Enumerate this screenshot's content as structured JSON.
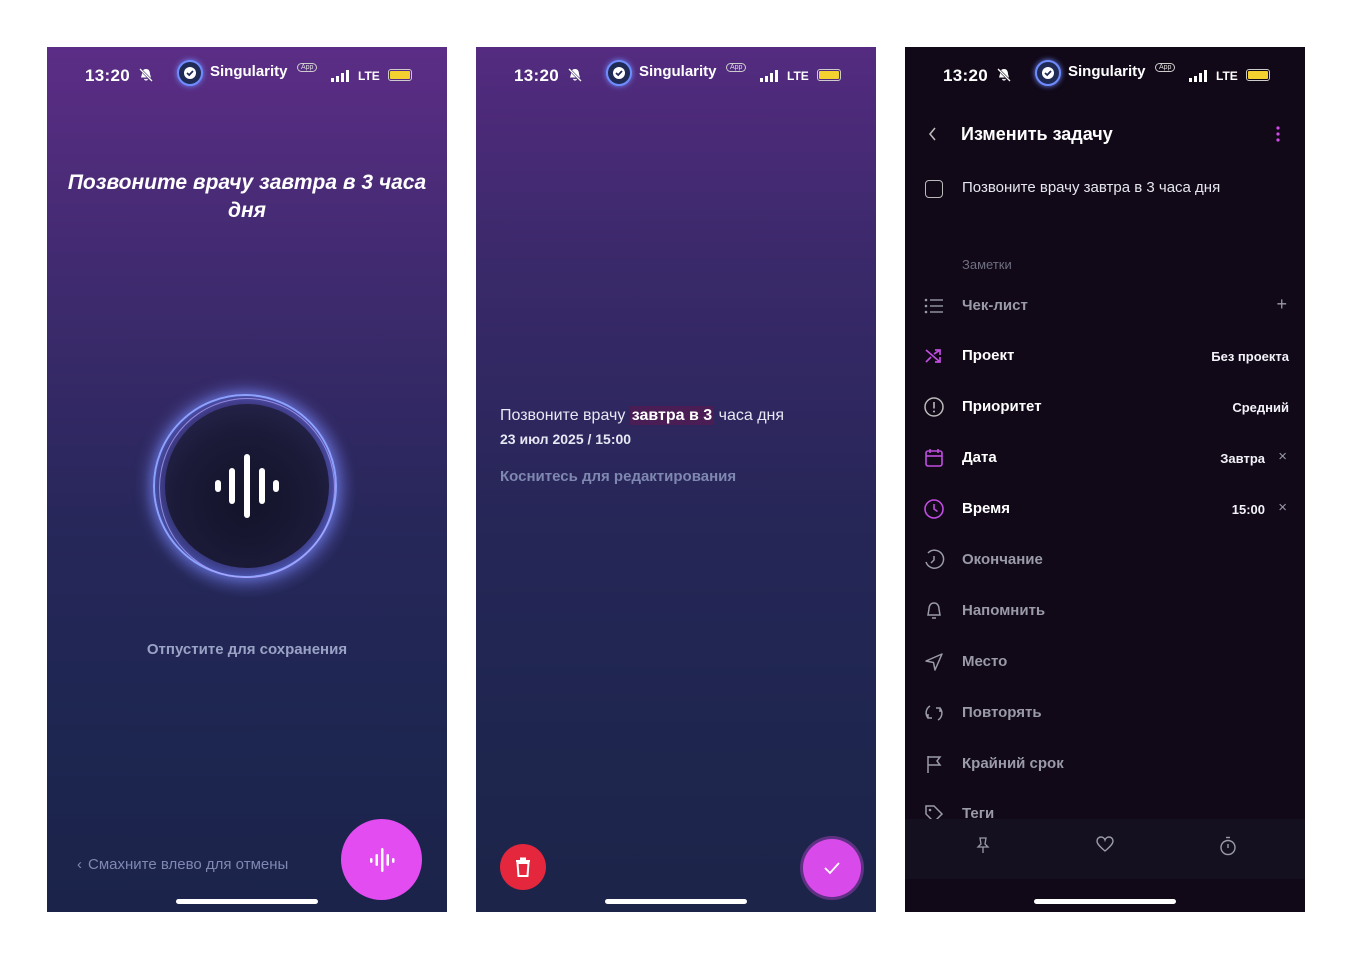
{
  "status_bar": {
    "time": "13:20",
    "app_name": "Singularity",
    "app_tag": "App",
    "network": "LTE"
  },
  "screen_record": {
    "title": "Позвоните врачу завтра в 3 часа дня",
    "hint": "Отпустите для сохранения",
    "cancel_hint": "Смахните влево для отмены"
  },
  "screen_confirm": {
    "task_prefix": "Позвоните врачу ",
    "task_highlight": "завтра в 3",
    "task_suffix": " часа дня",
    "datetime": "23 июл 2025 / 15:00",
    "edit_hint": "Коснитесь для редактирования"
  },
  "screen_edit": {
    "header_title": "Изменить задачу",
    "task_title": "Позвоните врачу завтра в 3 часа дня",
    "notes_placeholder": "Заметки",
    "rows": {
      "checklist": {
        "label": "Чек-лист",
        "action": "+"
      },
      "project": {
        "label": "Проект",
        "value": "Без проекта"
      },
      "priority": {
        "label": "Приоритет",
        "value": "Средний"
      },
      "date": {
        "label": "Дата",
        "value": "Завтра",
        "clear": "×"
      },
      "time": {
        "label": "Время",
        "value": "15:00",
        "clear": "×"
      },
      "end": {
        "label": "Окончание"
      },
      "remind": {
        "label": "Напомнить"
      },
      "place": {
        "label": "Место"
      },
      "repeat": {
        "label": "Повторять"
      },
      "deadline": {
        "label": "Крайний срок"
      },
      "tags": {
        "label": "Теги"
      }
    }
  },
  "colors": {
    "accent": "#e24cf0",
    "delete": "#e5273d",
    "battery": "#f5d130",
    "icon_highlight": "#c04de0"
  }
}
